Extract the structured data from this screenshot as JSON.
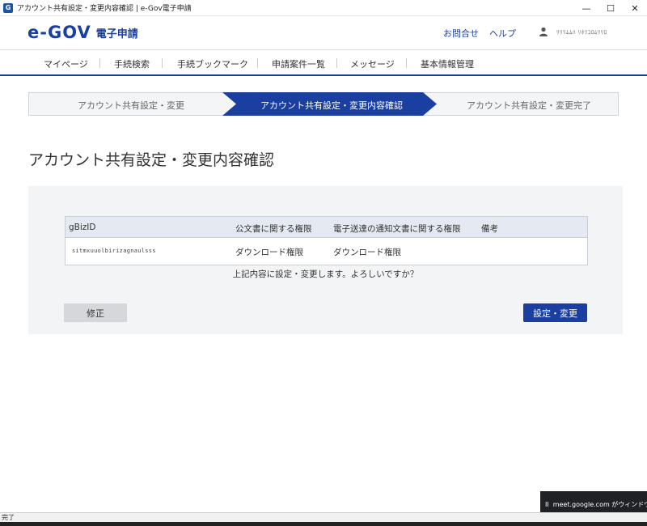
{
  "window": {
    "title": "アカウント共有設定・変更内容確認 | e-Gov電子申請",
    "app_icon": "G",
    "controls": [
      "—",
      "☐",
      "✕"
    ]
  },
  "header": {
    "logo_main": "e-GOV",
    "logo_sub": "電子申請",
    "links": {
      "contact": "お問合せ",
      "help": "ヘルプ"
    },
    "user_name": "ﾘﾘﾘﾑﾑﾊ ﾘﾎﾘｺﾛﾑﾘﾘﾛ"
  },
  "nav": {
    "items": [
      "マイページ",
      "手続検索",
      "手続ブックマーク",
      "申請案件一覧",
      "メッセージ",
      "基本情報管理"
    ]
  },
  "steps": [
    {
      "label": "アカウント共有設定・変更",
      "active": false
    },
    {
      "label": "アカウント共有設定・変更内容確認",
      "active": true
    },
    {
      "label": "アカウント共有設定・変更完了",
      "active": false
    }
  ],
  "page_title": "アカウント共有設定・変更内容確認",
  "table": {
    "headers": [
      "gBizID",
      "公文書に関する権限",
      "電子送達の通知文書に関する権限",
      "備考"
    ],
    "rows": [
      {
        "gbizid": "sitmxuuolbirizagnaulsss",
        "official_doc": "ダウンロード権限",
        "notice_doc": "ダウンロード権限",
        "remarks": ""
      }
    ]
  },
  "confirm_message": "上記内容に設定・変更します。よろしいですか？",
  "buttons": {
    "back": "修正",
    "submit": "設定・変更"
  },
  "status_bar": {
    "text": "完了"
  },
  "toast": {
    "icon": "II",
    "text": "meet.google.com がウィンドウを共有しています"
  },
  "colors": {
    "brand": "#1a3fa0",
    "header_bg": "#e4e9f2",
    "panel_bg": "#f3f4f6",
    "step_bg": "#f4f5f7"
  }
}
